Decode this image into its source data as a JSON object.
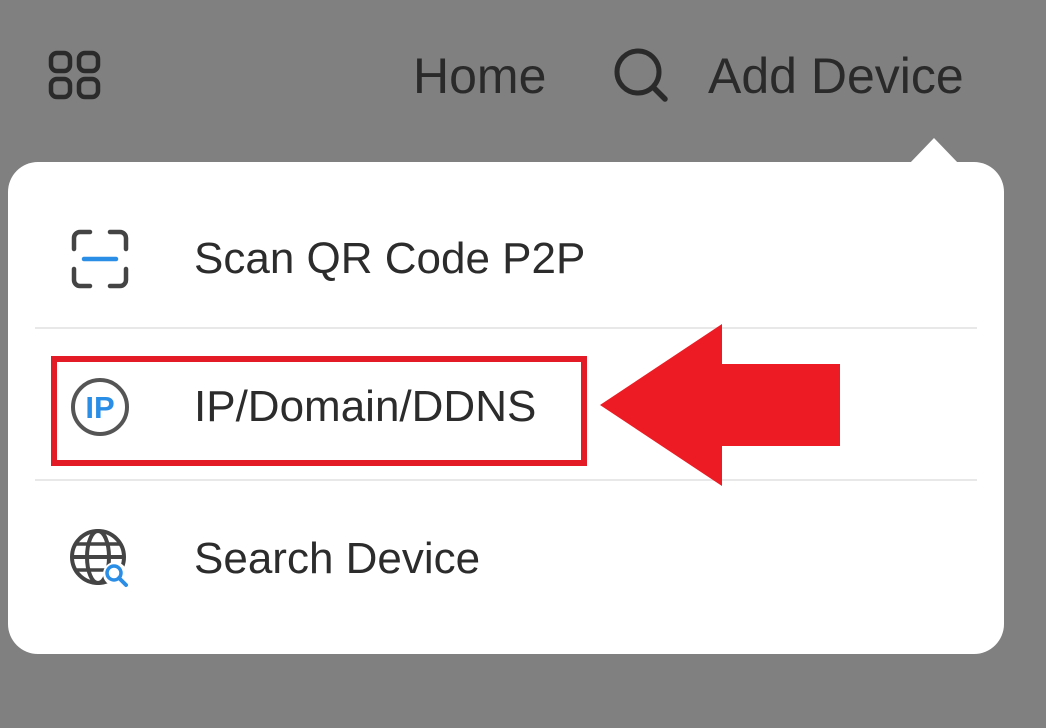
{
  "topbar": {
    "grid_icon": "grid-icon",
    "home_label": "Home",
    "search_icon": "search-icon",
    "add_device_label": "Add Device"
  },
  "menu": {
    "items": [
      {
        "label": "Scan QR Code P2P",
        "icon": "qr-scan-icon"
      },
      {
        "label": "IP/Domain/DDNS",
        "icon": "ip-icon",
        "highlighted": true
      },
      {
        "label": "Search Device",
        "icon": "globe-search-icon"
      }
    ]
  },
  "annotation": {
    "highlight_color": "#e31b26",
    "arrow_color": "#ed1c24",
    "arrow_icon": "left-arrow-icon"
  },
  "colors": {
    "overlay": "#808080",
    "popup_bg": "#ffffff",
    "ip_accent": "#2b8ee6"
  }
}
